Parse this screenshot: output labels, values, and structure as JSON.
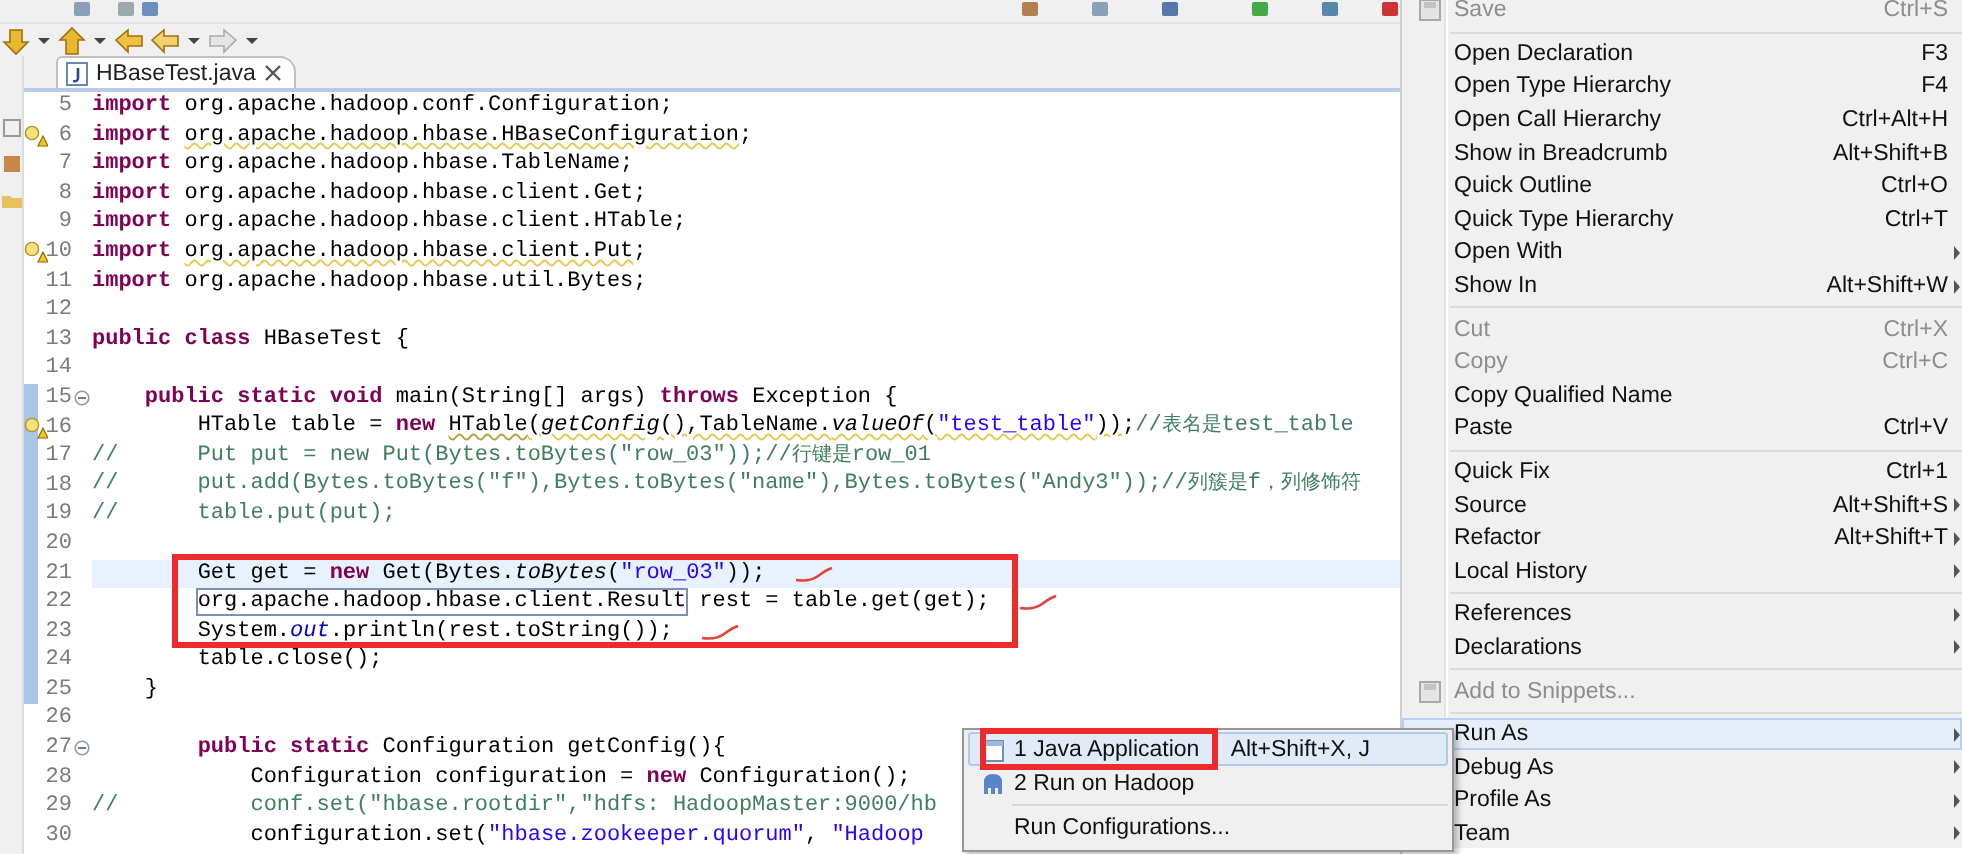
{
  "editor_tab": {
    "title": "HBaseTest.java",
    "selected": true
  },
  "lines": [
    {
      "number": "5",
      "segments": [
        {
          "text": "import",
          "kind": "keyword"
        },
        {
          "text": " org.apache.hadoop.conf.Configuration;",
          "kind": "plain"
        }
      ]
    },
    {
      "number": "6",
      "warning": true,
      "segments": [
        {
          "text": "import",
          "kind": "keyword"
        },
        {
          "text": " org.apache.hadoop.hbase.HBaseConfiguration",
          "kind": "warned"
        },
        {
          "text": ";",
          "kind": "plain"
        }
      ]
    },
    {
      "number": "7",
      "segments": [
        {
          "text": "import",
          "kind": "keyword"
        },
        {
          "text": " org.apache.hadoop.hbase.TableName;",
          "kind": "plain"
        }
      ]
    },
    {
      "number": "8",
      "segments": [
        {
          "text": "import",
          "kind": "keyword"
        },
        {
          "text": " org.apache.hadoop.hbase.client.Get;",
          "kind": "plain"
        }
      ]
    },
    {
      "number": "9",
      "segments": [
        {
          "text": "import",
          "kind": "keyword"
        },
        {
          "text": " org.apache.hadoop.hbase.client.HTable;",
          "kind": "plain"
        }
      ]
    },
    {
      "number": "10",
      "warning": true,
      "segments": [
        {
          "text": "import",
          "kind": "keyword"
        },
        {
          "text": " org.apache.hadoop.hbase.client.Put",
          "kind": "warned"
        },
        {
          "text": ";",
          "kind": "plain"
        }
      ]
    },
    {
      "number": "11",
      "segments": [
        {
          "text": "import",
          "kind": "keyword"
        },
        {
          "text": " org.apache.hadoop.hbase.util.Bytes;",
          "kind": "plain"
        }
      ]
    },
    {
      "number": "12"
    },
    {
      "number": "13",
      "segments": [
        {
          "text": "public",
          "kind": "keyword"
        },
        {
          "text": " class",
          "kind": "keyword"
        },
        {
          "text": " HBaseTest {",
          "kind": "plain"
        }
      ]
    },
    {
      "number": "14"
    },
    {
      "number": "15",
      "fold": true,
      "range": true,
      "segments": [
        {
          "text": "    public",
          "kind": "keyword"
        },
        {
          "text": " static",
          "kind": "keyword"
        },
        {
          "text": " void",
          "kind": "keyword"
        },
        {
          "text": " main(String[] args) ",
          "kind": "plain"
        },
        {
          "text": "throws",
          "kind": "keyword"
        },
        {
          "text": " Exception {",
          "kind": "plain"
        }
      ]
    },
    {
      "number": "16",
      "warning": true,
      "range": true,
      "segments": [
        {
          "text": "        HTable table = ",
          "kind": "plain"
        },
        {
          "text": "new",
          "kind": "keyword"
        },
        {
          "text": " HTable",
          "kind": "deprecated"
        },
        {
          "text": "(",
          "kind": "warned"
        },
        {
          "text": "getConfig",
          "kind": "warned-static"
        },
        {
          "text": "(),TableName.",
          "kind": "warned"
        },
        {
          "text": "valueOf",
          "kind": "warned-static"
        },
        {
          "text": "(",
          "kind": "warned"
        },
        {
          "text": "\"test_table\"",
          "kind": "warned-string"
        },
        {
          "text": "))",
          "kind": "warned"
        },
        {
          "text": ";",
          "kind": "plain"
        },
        {
          "text": "//表名是test_table",
          "kind": "comment"
        }
      ]
    },
    {
      "number": "17",
      "range": true,
      "segments": [
        {
          "text": "//      Put put = new Put(Bytes.toBytes(\"row_03\"));//行键是row_01",
          "kind": "comment"
        }
      ]
    },
    {
      "number": "18",
      "range": true,
      "segments": [
        {
          "text": "//      put.add(Bytes.toBytes(\"f\"),Bytes.toBytes(\"name\"),Bytes.toBytes(\"Andy3\"));//列簇是f，列修饰符",
          "kind": "comment"
        }
      ]
    },
    {
      "number": "19",
      "range": true,
      "segments": [
        {
          "text": "//      table.put(put);",
          "kind": "comment"
        }
      ]
    },
    {
      "number": "20",
      "range": true
    },
    {
      "number": "21",
      "range": true,
      "current": true,
      "annotated": true,
      "scribble": true,
      "segments": [
        {
          "text": "        Get get = ",
          "kind": "plain"
        },
        {
          "text": "new",
          "kind": "keyword"
        },
        {
          "text": " Get(Bytes.",
          "kind": "plain"
        },
        {
          "text": "toBytes",
          "kind": "static"
        },
        {
          "text": "(",
          "kind": "plain"
        },
        {
          "text": "\"row_03\"",
          "kind": "string"
        },
        {
          "text": "));",
          "kind": "plain"
        }
      ]
    },
    {
      "number": "22",
      "range": true,
      "annotated": true,
      "scribble": true,
      "segments": [
        {
          "text": "        org.apache.hadoop.hbase.client.Result",
          "kind": "boxed"
        },
        {
          "text": " rest = table.get(get);",
          "kind": "plain"
        }
      ]
    },
    {
      "number": "23",
      "range": true,
      "annotated": true,
      "scribble": true,
      "segments": [
        {
          "text": "        System.",
          "kind": "plain"
        },
        {
          "text": "out",
          "kind": "field"
        },
        {
          "text": ".println(rest.toString());",
          "kind": "plain"
        }
      ]
    },
    {
      "number": "24",
      "range": true,
      "segments": [
        {
          "text": "        table.close();",
          "kind": "plain"
        }
      ]
    },
    {
      "number": "25",
      "range": true,
      "segments": [
        {
          "text": "    }",
          "kind": "plain"
        }
      ]
    },
    {
      "number": "26"
    },
    {
      "number": "27",
      "fold": true,
      "segments": [
        {
          "text": "        public",
          "kind": "keyword"
        },
        {
          "text": " static",
          "kind": "keyword"
        },
        {
          "text": " Configuration getConfig(){",
          "kind": "plain"
        }
      ]
    },
    {
      "number": "28",
      "segments": [
        {
          "text": "            Configuration configuration = ",
          "kind": "plain"
        },
        {
          "text": "new",
          "kind": "keyword"
        },
        {
          "text": " Configuration();",
          "kind": "plain"
        }
      ]
    },
    {
      "number": "29",
      "segments": [
        {
          "text": "//          conf.set(\"hbase.rootdir\",\"hdfs: HadoopMaster:9000/hb",
          "kind": "comment"
        }
      ]
    },
    {
      "number": "30",
      "segments": [
        {
          "text": "            configuration.set(",
          "kind": "plain"
        },
        {
          "text": "\"hbase.zookeeper.quorum\"",
          "kind": "string"
        },
        {
          "text": ", ",
          "kind": "plain"
        },
        {
          "text": "\"Hadoop",
          "kind": "string"
        }
      ]
    }
  ],
  "context_menu": {
    "items": [
      {
        "kind": "item",
        "label": "Save",
        "shortcut": "Ctrl+S",
        "disabled": true,
        "selected": false,
        "has_icon": true
      },
      {
        "kind": "separator"
      },
      {
        "kind": "item",
        "label": "Open Declaration",
        "shortcut": "F3",
        "selected": false
      },
      {
        "kind": "item",
        "label": "Open Type Hierarchy",
        "shortcut": "F4",
        "selected": false
      },
      {
        "kind": "item",
        "label": "Open Call Hierarchy",
        "shortcut": "Ctrl+Alt+H",
        "selected": false
      },
      {
        "kind": "item",
        "label": "Show in Breadcrumb",
        "shortcut": "Alt+Shift+B",
        "selected": false
      },
      {
        "kind": "item",
        "label": "Quick Outline",
        "shortcut": "Ctrl+O",
        "selected": false
      },
      {
        "kind": "item",
        "label": "Quick Type Hierarchy",
        "shortcut": "Ctrl+T",
        "selected": false
      },
      {
        "kind": "item",
        "label": "Open With",
        "selected": false,
        "submenu": true
      },
      {
        "kind": "item",
        "label": "Show In",
        "shortcut": "Alt+Shift+W",
        "selected": false,
        "submenu": true
      },
      {
        "kind": "separator"
      },
      {
        "kind": "item",
        "label": "Cut",
        "shortcut": "Ctrl+X",
        "disabled": true,
        "selected": false
      },
      {
        "kind": "item",
        "label": "Copy",
        "shortcut": "Ctrl+C",
        "disabled": true,
        "selected": false
      },
      {
        "kind": "item",
        "label": "Copy Qualified Name",
        "selected": false
      },
      {
        "kind": "item",
        "label": "Paste",
        "shortcut": "Ctrl+V",
        "selected": false
      },
      {
        "kind": "separator"
      },
      {
        "kind": "item",
        "label": "Quick Fix",
        "shortcut": "Ctrl+1",
        "selected": false
      },
      {
        "kind": "item",
        "label": "Source",
        "shortcut": "Alt+Shift+S",
        "selected": false,
        "submenu": true
      },
      {
        "kind": "item",
        "label": "Refactor",
        "shortcut": "Alt+Shift+T",
        "selected": false,
        "submenu": true
      },
      {
        "kind": "item",
        "label": "Local History",
        "selected": false,
        "submenu": true
      },
      {
        "kind": "separator"
      },
      {
        "kind": "item",
        "label": "References",
        "selected": false,
        "submenu": true
      },
      {
        "kind": "item",
        "label": "Declarations",
        "selected": false,
        "submenu": true
      },
      {
        "kind": "separator"
      },
      {
        "kind": "item",
        "label": "Add to Snippets...",
        "disabled": true,
        "selected": false,
        "has_icon": true
      },
      {
        "kind": "separator"
      },
      {
        "kind": "item",
        "label": "Run As",
        "selected": true,
        "submenu": true
      },
      {
        "kind": "item",
        "label": "Debug As",
        "selected": false,
        "submenu": true
      },
      {
        "kind": "item",
        "label": "Profile As",
        "selected": false,
        "submenu": true
      },
      {
        "kind": "item",
        "label": "Team",
        "selected": false,
        "submenu": true
      }
    ]
  },
  "run_as_submenu": {
    "items": [
      {
        "kind": "item",
        "label": "1 Java Application",
        "shortcut": "Alt+Shift+X, J",
        "selected": true,
        "annotated": true
      },
      {
        "kind": "item",
        "label": "2 Run on Hadoop",
        "selected": false
      },
      {
        "kind": "separator"
      },
      {
        "kind": "item",
        "label": "Run Configurations...",
        "selected": false
      }
    ]
  }
}
